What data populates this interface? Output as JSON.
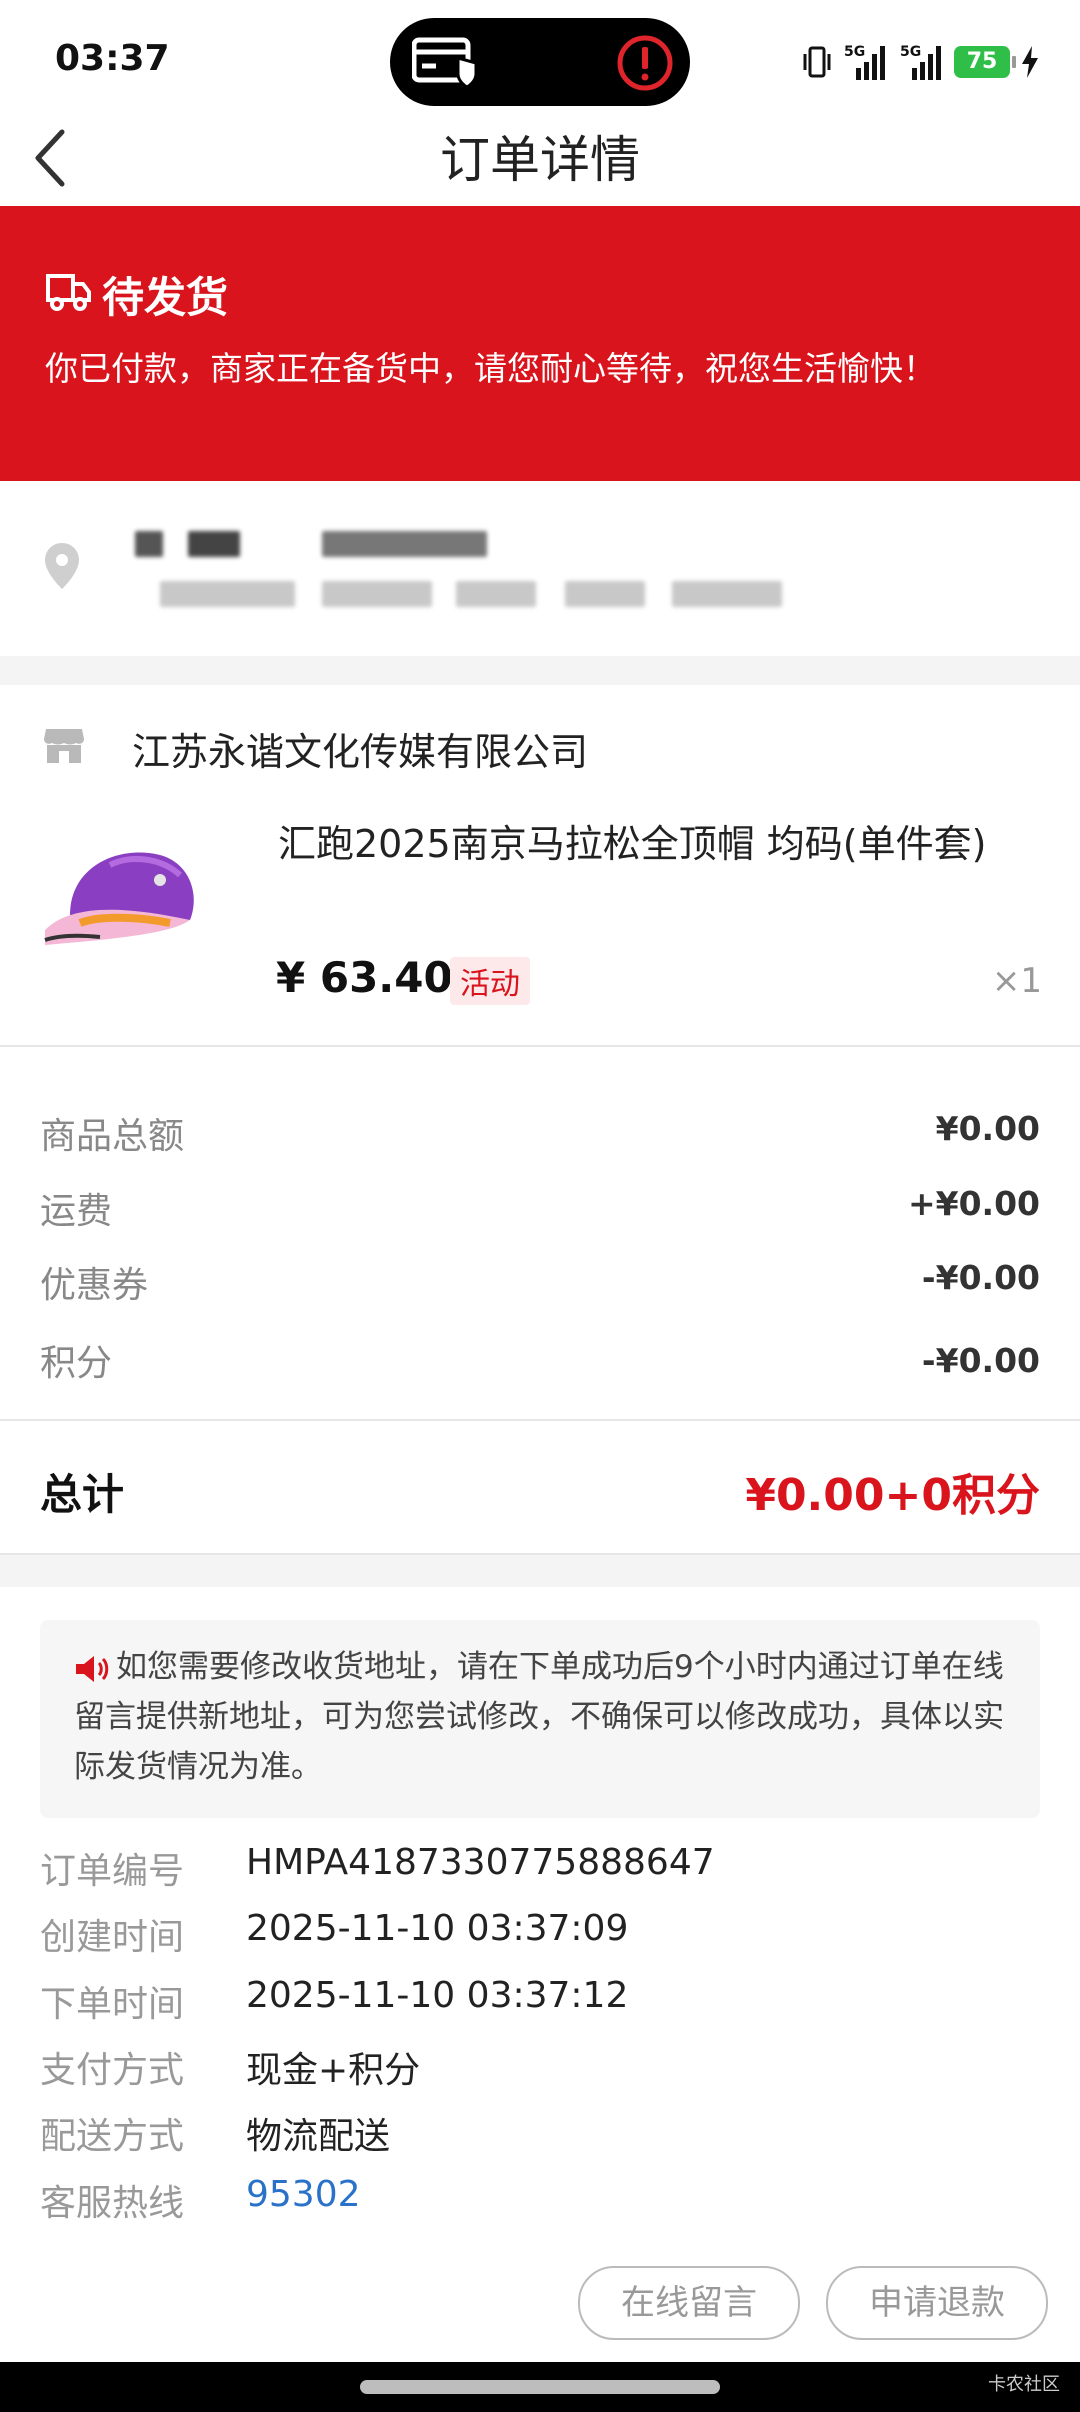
{
  "status_bar": {
    "time": "03:37",
    "battery": "75",
    "network_1": "5G",
    "network_2": "5G"
  },
  "header": {
    "title": "订单详情"
  },
  "banner": {
    "status_title": "待发货",
    "status_desc": "你已付款，商家正在备货中，请您耐心等待，祝您生活愉快！",
    "color": "#d9141d"
  },
  "store": {
    "name": "江苏永谐文化传媒有限公司",
    "product_name": "汇跑2025南京马拉松全顶帽 均码(单件套)",
    "price": "¥ 63.40",
    "tag": "活动",
    "qty": "×1"
  },
  "fees": [
    {
      "label": "商品总额",
      "value": "¥0.00"
    },
    {
      "label": "运费",
      "value": "+¥0.00"
    },
    {
      "label": "优惠券",
      "value": "-¥0.00"
    },
    {
      "label": "积分",
      "value": "-¥0.00"
    }
  ],
  "total": {
    "label": "总计",
    "value": "¥0.00+0积分"
  },
  "notice": {
    "text": "如您需要修改收货地址，请在下单成功后9个小时内通过订单在线留言提供新地址，可为您尝试修改，不确保可以修改成功，具体以实际发货情况为准。"
  },
  "info": [
    {
      "label": "订单编号",
      "value": "HMPA4187330775888647"
    },
    {
      "label": "创建时间",
      "value": "2025-11-10 03:37:09"
    },
    {
      "label": "下单时间",
      "value": "2025-11-10 03:37:12"
    },
    {
      "label": "支付方式",
      "value": "现金+积分"
    },
    {
      "label": "配送方式",
      "value": "物流配送"
    },
    {
      "label": "客服热线",
      "value": "95302"
    }
  ],
  "actions": {
    "message": "在线留言",
    "refund": "申请退款"
  },
  "watermark": "卡农社区"
}
